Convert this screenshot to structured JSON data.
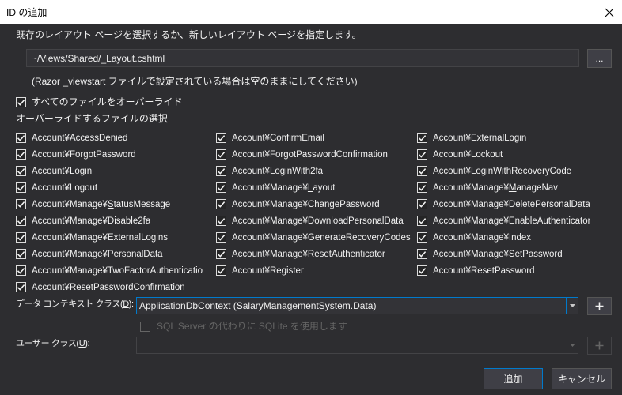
{
  "window": {
    "title": "ID の追加"
  },
  "layout_page": {
    "instruction": "既存のレイアウト ページを選択するか、新しいレイアウト ページを指定します。",
    "path_value": "~/Views/Shared/_Layout.cshtml",
    "browse_label": "...",
    "note": "(Razor _viewstart ファイルで設定されている場合は空のままにしてください)"
  },
  "override_all": {
    "label": "すべてのファイルをオーバーライド",
    "checked": true
  },
  "files": {
    "heading": "オーバーライドするファイルの選択",
    "items": [
      {
        "text": "Account¥AccessDenied",
        "checked": true
      },
      {
        "text": "Account¥ConfirmEmail",
        "checked": true
      },
      {
        "text": "Account¥ExternalLogin",
        "checked": true
      },
      {
        "text": "Account¥ForgotPassword",
        "checked": true
      },
      {
        "text": "Account¥ForgotPasswordConfirmation",
        "checked": true
      },
      {
        "text": "Account¥Lockout",
        "checked": true
      },
      {
        "text": "Account¥Login",
        "checked": true
      },
      {
        "text": "Account¥LoginWith2fa",
        "checked": true
      },
      {
        "text": "Account¥LoginWithRecoveryCode",
        "checked": true
      },
      {
        "text": "Account¥Logout",
        "checked": true
      },
      {
        "text": "Account¥Manage¥",
        "access_key": "L",
        "text_after": "ayout",
        "checked": true
      },
      {
        "text": "Account¥Manage¥",
        "access_key": "M",
        "text_after": "anageNav",
        "checked": true
      },
      {
        "text": "Account¥Manage¥",
        "access_key": "S",
        "text_after": "tatusMessage",
        "checked": true
      },
      {
        "text": "Account¥Manage¥ChangePassword",
        "checked": true
      },
      {
        "text": "Account¥Manage¥DeletePersonalData",
        "checked": true
      },
      {
        "text": "Account¥Manage¥Disable2fa",
        "checked": true
      },
      {
        "text": "Account¥Manage¥DownloadPersonalData",
        "checked": true
      },
      {
        "text": "Account¥Manage¥EnableAuthenticator",
        "checked": true
      },
      {
        "text": "Account¥Manage¥ExternalLogins",
        "checked": true
      },
      {
        "text": "Account¥Manage¥GenerateRecoveryCodes",
        "checked": true
      },
      {
        "text": "Account¥Manage¥Index",
        "checked": true
      },
      {
        "text": "Account¥Manage¥PersonalData",
        "checked": true
      },
      {
        "text": "Account¥Manage¥ResetAuthenticator",
        "checked": true
      },
      {
        "text": "Account¥Manage¥SetPassword",
        "checked": true
      },
      {
        "text": "Account¥Manage¥TwoFactorAuthenticatio",
        "checked": true
      },
      {
        "text": "Account¥Register",
        "checked": true
      },
      {
        "text": "Account¥ResetPassword",
        "checked": true
      },
      {
        "text": "Account¥ResetPasswordConfirmation",
        "checked": true
      }
    ]
  },
  "data_context": {
    "label": "データ コンテキスト クラス(",
    "access_key": "D",
    "label_after": "):",
    "selected": "ApplicationDbContext (SalaryManagementSystem.Data)",
    "enabled": true
  },
  "use_sqlite": {
    "label": "SQL Server の代わりに SQLite を使用します",
    "checked": false,
    "enabled": false
  },
  "user_class": {
    "label": "ユーザー クラス(",
    "access_key": "U",
    "label_after": "):",
    "enabled": false
  },
  "footer": {
    "add_label": "追加",
    "cancel_label": "キャンセル"
  },
  "icons": {
    "close": "close-icon",
    "checkbox_check": "checkmark-icon",
    "dropdown": "chevron-down-icon",
    "add": "plus-icon"
  },
  "colors": {
    "background": "#2d2d30",
    "text": "#f1f1f1",
    "accent": "#007acc",
    "disabled_text": "#656565",
    "title_bar": "#ffffff"
  }
}
